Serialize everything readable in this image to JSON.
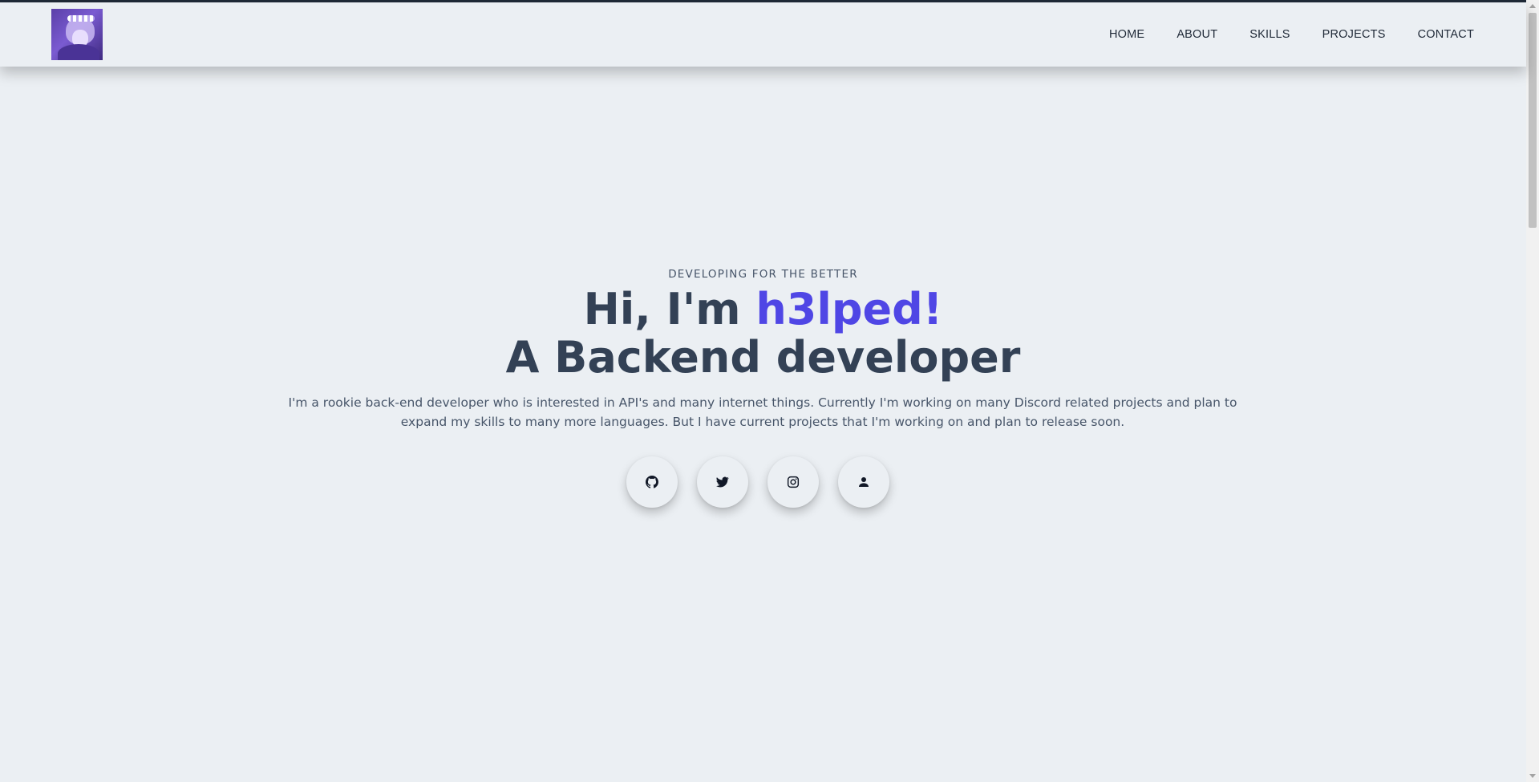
{
  "nav": {
    "logo_alt": "avatar logo",
    "links": [
      {
        "label": "HOME"
      },
      {
        "label": "ABOUT"
      },
      {
        "label": "SKILLS"
      },
      {
        "label": "PROJECTS"
      },
      {
        "label": "CONTACT"
      }
    ]
  },
  "hero": {
    "eyebrow": "DEVELOPING FOR THE BETTER",
    "greeting": "Hi, I'm ",
    "name": "h3lped!",
    "role": "A Backend developer",
    "description": "I'm a rookie back-end developer who is interested in API's and many internet things. Currently I'm working on many Discord related projects and plan to expand my skills to many more languages. But I have current projects that I'm working on and plan to release soon."
  },
  "socials": [
    {
      "icon": "github-icon"
    },
    {
      "icon": "twitter-icon"
    },
    {
      "icon": "instagram-icon"
    },
    {
      "icon": "user-icon"
    }
  ],
  "colors": {
    "accent": "#4f46e5",
    "text": "#334155",
    "background": "#ebeff3"
  }
}
